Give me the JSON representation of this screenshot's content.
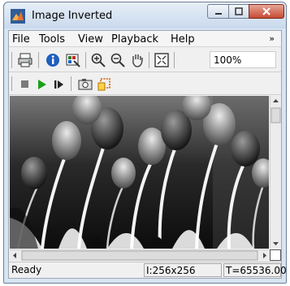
{
  "window": {
    "title": "Image Inverted"
  },
  "menu": {
    "items": [
      "File",
      "Tools",
      "View",
      "Playback",
      "Help"
    ],
    "overflow_glyph": "»"
  },
  "toolbar": {
    "zoom_value": "100%",
    "icons": [
      "print-icon",
      "info-icon",
      "pixel-region-icon",
      "zoom-in-icon",
      "zoom-out-icon",
      "pan-hand-icon",
      "fit-to-window-icon"
    ]
  },
  "playback": {
    "icons": [
      "stop-icon",
      "play-icon",
      "step-forward-icon",
      "snapshot-icon",
      "highlight-icon"
    ]
  },
  "status": {
    "left": "Ready",
    "size": "I:256x256",
    "time": "T=65536.00"
  }
}
